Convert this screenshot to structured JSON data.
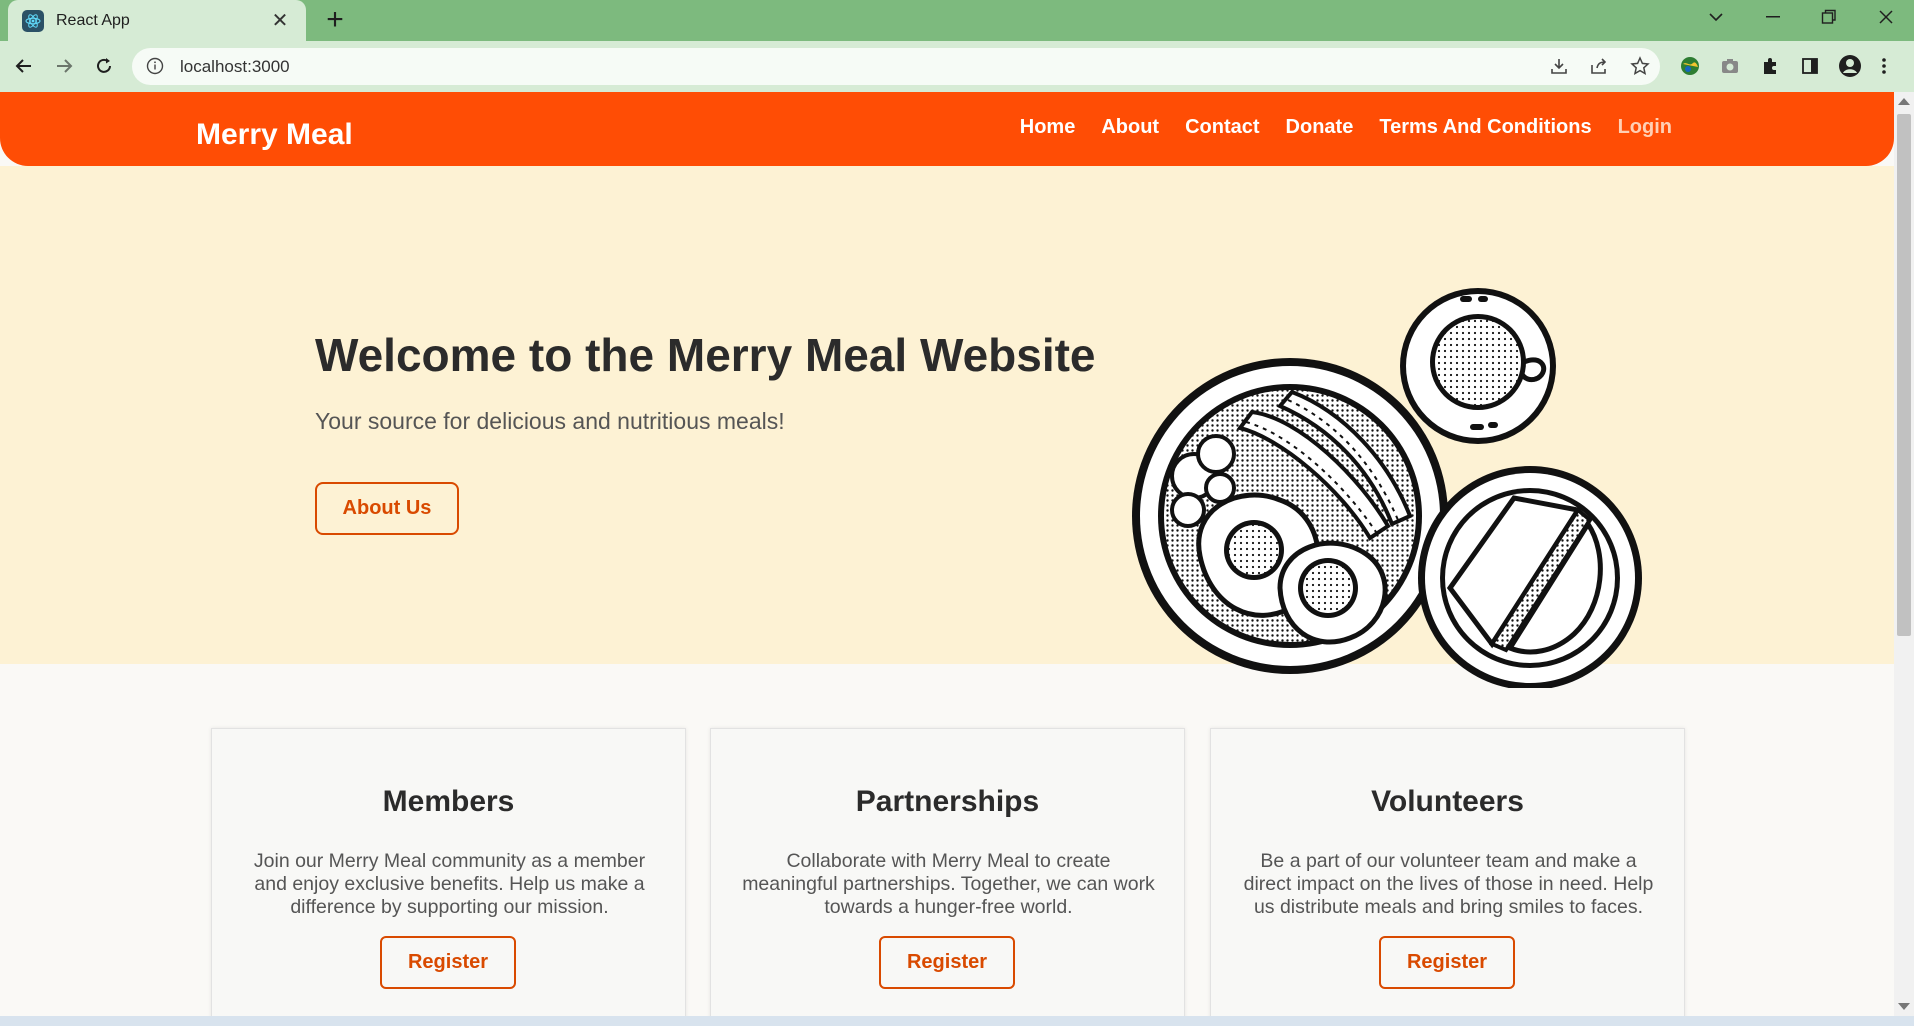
{
  "browser": {
    "tab_title": "React App",
    "url": "localhost:3000",
    "tab_icon": "react-icon",
    "colors": {
      "tabstrip": "#7dba7e",
      "toolbar": "#d6ebd5"
    }
  },
  "site": {
    "brand": "Merry Meal",
    "nav": {
      "home": "Home",
      "about": "About",
      "contact": "Contact",
      "donate": "Donate",
      "terms": "Terms And Conditions",
      "login": "Login"
    },
    "colors": {
      "header": "#ff4d05",
      "hero_bg": "#fdf2d4",
      "accent": "#d94a00"
    }
  },
  "hero": {
    "title": "Welcome to the Merry Meal Website",
    "subtitle": "Your source for delicious and nutritious meals!",
    "button": "About Us"
  },
  "cards": [
    {
      "title": "Members",
      "text": "Join our Merry Meal community as a member and enjoy exclusive benefits. Help us make a difference by supporting our mission.",
      "button": "Register"
    },
    {
      "title": "Partnerships",
      "text": "Collaborate with Merry Meal to create meaningful partnerships. Together, we can work towards a hunger-free world.",
      "button": "Register"
    },
    {
      "title": "Volunteers",
      "text": "Be a part of our volunteer team and make a direct impact on the lives of those in need. Help us distribute meals and bring smiles to faces.",
      "button": "Register"
    }
  ]
}
